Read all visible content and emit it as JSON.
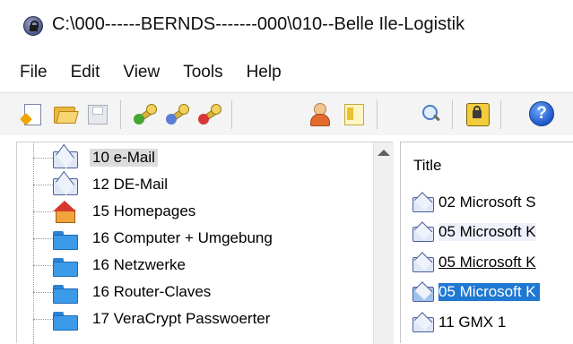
{
  "window": {
    "title": "C:\\000------BERNDS-------000\\010--Belle Ile-Logistik",
    "app_icon": "lock-globe-icon"
  },
  "menu": [
    "File",
    "Edit",
    "View",
    "Tools",
    "Help"
  ],
  "toolbar": {
    "buttons": [
      {
        "name": "new-database",
        "icon": "new-document-icon"
      },
      {
        "name": "open-database",
        "icon": "open-folder-icon"
      },
      {
        "name": "save-database",
        "icon": "save-disk-icon",
        "enabled": false
      },
      {
        "name": "add-entry",
        "icon": "key-add-icon"
      },
      {
        "name": "edit-entry",
        "icon": "key-edit-icon"
      },
      {
        "name": "delete-entry",
        "icon": "key-delete-icon"
      },
      {
        "name": "user-profile",
        "icon": "user-icon"
      },
      {
        "name": "notes",
        "icon": "note-icon"
      },
      {
        "name": "find",
        "icon": "search-icon"
      },
      {
        "name": "lock-workspace",
        "icon": "lock-icon"
      },
      {
        "name": "help",
        "icon": "help-icon",
        "glyph": "?"
      }
    ],
    "annotation": {
      "icon": "red-arrow-up-icon",
      "color": "#ea0a0a"
    }
  },
  "tree": {
    "items": [
      {
        "label": "10 e-Mail",
        "icon": "mail-icon",
        "selected": true
      },
      {
        "label": "12 DE-Mail",
        "icon": "mail-icon",
        "selected": false
      },
      {
        "label": "15 Homepages",
        "icon": "home-icon",
        "selected": false
      },
      {
        "label": "16 Computer + Umgebung",
        "icon": "folder-icon",
        "selected": false
      },
      {
        "label": "16 Netzwerke",
        "icon": "folder-icon",
        "selected": false
      },
      {
        "label": "16 Router-Claves",
        "icon": "folder-icon",
        "selected": false
      },
      {
        "label": "17 VeraCrypt Passwoerter",
        "icon": "folder-icon",
        "selected": false
      }
    ]
  },
  "list": {
    "column_header": "Title",
    "items": [
      {
        "title": "02 Microsoft S",
        "style": "normal"
      },
      {
        "title": "05 Microsoft K",
        "style": "alt"
      },
      {
        "title": "05 Microsoft K",
        "style": "underline"
      },
      {
        "title": "05 Microsoft K",
        "style": "selected"
      },
      {
        "title": "11 GMX 1",
        "style": "normal"
      }
    ]
  },
  "colors": {
    "selection": "#1f78d1",
    "toolbar_bg": "#f4f4f4",
    "arrow": "#ea0a0a"
  }
}
